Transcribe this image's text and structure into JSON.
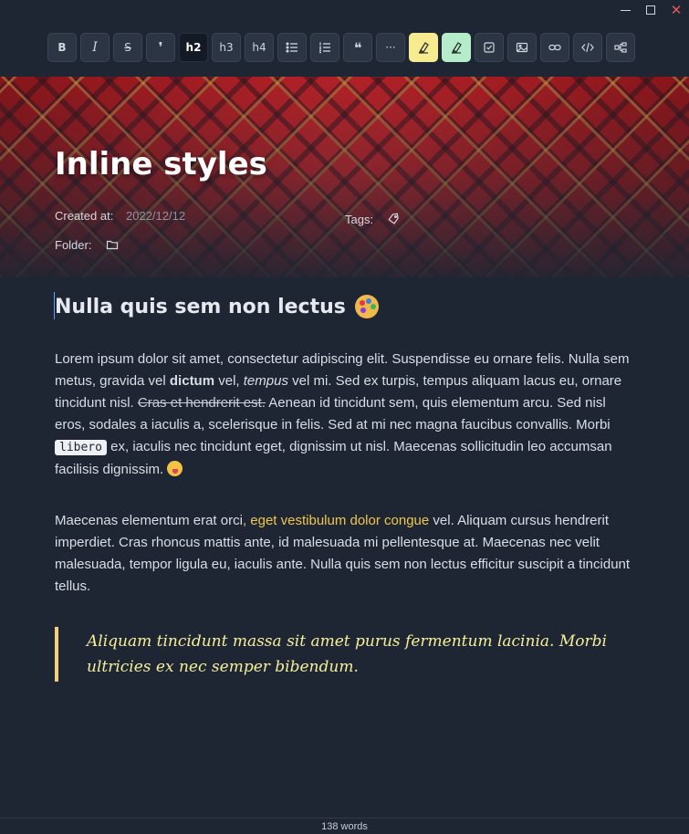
{
  "window": {
    "minimize_icon": "minimize-icon",
    "maximize_icon": "maximize-icon",
    "close_icon": "close-icon",
    "close_symbol": "✕"
  },
  "toolbar": {
    "bold": "B",
    "italic": "I",
    "strike": "S",
    "quote_inline": "❜",
    "h2": "h2",
    "h3": "h3",
    "h4": "h4",
    "blockquote": "❝",
    "more": "···",
    "highlight_yellow_color": "#f6ec8f",
    "highlight_green_color": "#b5ecc9"
  },
  "header": {
    "title": "Inline styles",
    "created_label": "Created at:",
    "created_value": "2022/12/12",
    "tags_label": "Tags:",
    "folder_label": "Folder:"
  },
  "document": {
    "heading": "Nulla quis sem non lectus",
    "p1": {
      "t1": "Lorem ipsum dolor sit amet, consectetur adipiscing elit. Suspendisse eu ornare felis. Nulla sem metus, gravida vel ",
      "bold": "dictum",
      "t2": " vel, ",
      "italic": "tempus",
      "t3": " vel mi. Sed ex turpis, tempus aliquam lacus eu, ornare tincidunt nisl. ",
      "strike": "Cras et hendrerit est.",
      "t4": " Aenean id tincidunt sem, quis elementum arcu. Sed nisl eros, sodales a iaculis a, scelerisque in felis. Sed at mi nec magna faucibus convallis. Morbi ",
      "code": "libero",
      "t5": " ex, iaculis nec tincidunt eget, dignissim ut nisl. Maecenas sollicitudin leo accumsan facilisis dignissim. "
    },
    "p2": {
      "t1": "Maecenas elementum erat orci",
      "link": ", eget vestibulum dolor congue",
      "t2": " vel. Aliquam cursus hendrerit imperdiet. Cras rhoncus mattis ante, id malesuada mi pellentesque at. Maecenas nec velit malesuada, tempor ligula eu, iaculis ante. Nulla quis sem non lectus efficitur suscipit a tincidunt tellus."
    },
    "quote": "Aliquam tincidunt massa sit amet purus fermentum lacinia. Morbi ultricies ex nec semper bibendum."
  },
  "status": {
    "word_count": "138 words"
  },
  "colors": {
    "background": "#1e2633",
    "link": "#f2c64a",
    "quote_text": "#f5ef9a",
    "quote_border": "#f1d27a"
  }
}
